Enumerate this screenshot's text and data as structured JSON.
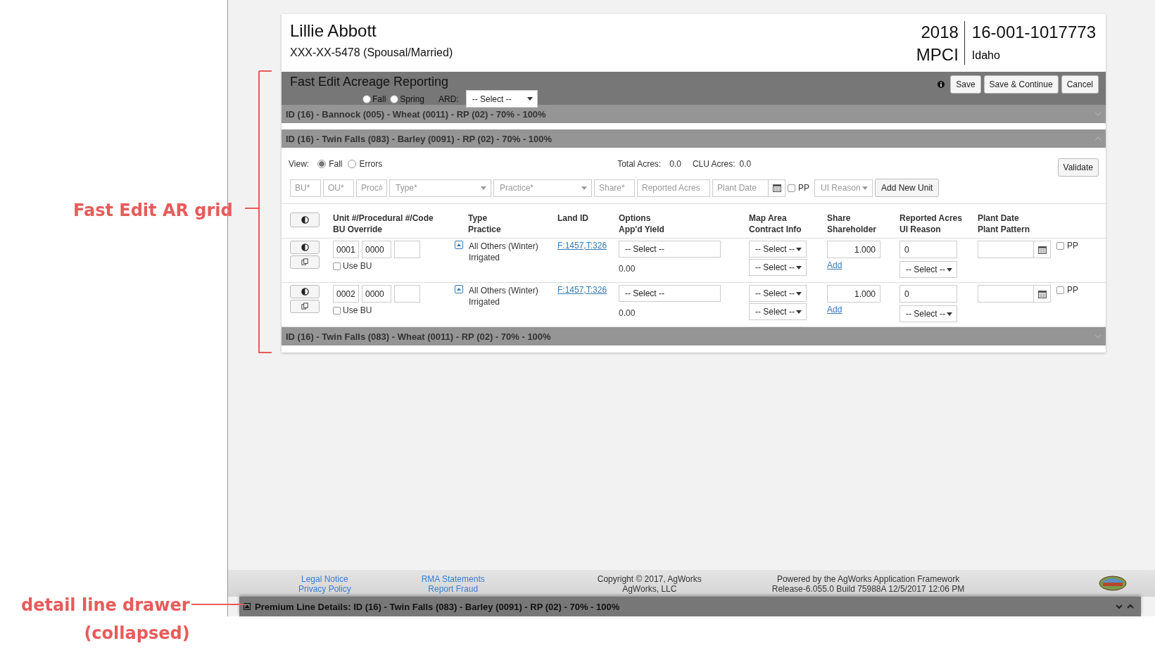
{
  "annotations": [
    {
      "kind": "bracket",
      "lines": [
        "Fast Edit AR grid"
      ]
    },
    {
      "kind": "leader",
      "lines": [
        "detail line drawer",
        "(collapsed)"
      ]
    }
  ],
  "header": {
    "name": "Lillie Abbott",
    "ssn": "XXX-XX-5478 (Spousal/Married)",
    "year": "2018",
    "program": "MPCI",
    "policy": "16-001-1017773",
    "state": "Idaho"
  },
  "toolbar": {
    "title": "Fast Edit Acreage Reporting",
    "seasons": [
      {
        "label": "Fall",
        "selected": false
      },
      {
        "label": "Spring",
        "selected": false
      }
    ],
    "ard_label": "ARD:",
    "ard_select": "-- Select --",
    "buttons": [
      "Save",
      "Save & Continue",
      "Cancel"
    ]
  },
  "sections": [
    {
      "title": "ID (16) - Bannock (005) - Wheat (0011) - RP (02) - 70% - 100%",
      "expanded": false
    },
    {
      "title": "ID (16) - Twin Falls (083) - Barley (0091) - RP (02) - 70% - 100%",
      "expanded": true
    },
    {
      "title": "ID (16) - Twin Falls (083) - Wheat (0011) - RP (02) - 70% - 100%",
      "expanded": false
    }
  ],
  "grid": {
    "view_label": "View:",
    "view_options": [
      {
        "label": "Fall",
        "selected": true
      },
      {
        "label": "Errors",
        "selected": false
      }
    ],
    "total_acres_label": "Total Acres:",
    "total_acres": "0.0",
    "clu_acres_label": "CLU Acres:",
    "clu_acres": "0.0",
    "validate_button": "Validate",
    "entry_fields": [
      {
        "kind": "input",
        "placeholder": "BU*"
      },
      {
        "kind": "input",
        "placeholder": "OU*"
      },
      {
        "kind": "input",
        "placeholder": "Proc#"
      },
      {
        "kind": "select",
        "placeholder": "Type*"
      },
      {
        "kind": "select",
        "placeholder": "Practice*"
      },
      {
        "kind": "input",
        "placeholder": "Share*"
      },
      {
        "kind": "input",
        "placeholder": "Reported Acres"
      },
      {
        "kind": "date",
        "placeholder": "Plant Date"
      },
      {
        "kind": "checkbox",
        "label": "PP",
        "checked": false
      },
      {
        "kind": "select",
        "placeholder": "UI Reason"
      },
      {
        "kind": "button",
        "label": "Add New Unit"
      }
    ],
    "columns": [
      {
        "title": "Unit #/Procedural #/Code",
        "subtitle": "BU Override"
      },
      {
        "title": "Type",
        "subtitle": "Practice"
      },
      {
        "title": "Land ID"
      },
      {
        "title": "Options",
        "subtitle": "App'd Yield"
      },
      {
        "title": "Map Area",
        "subtitle": "Contract Info"
      },
      {
        "title": "Share",
        "subtitle": "Shareholder"
      },
      {
        "title": "Reported Acres",
        "subtitle": "UI Reason"
      },
      {
        "title": "Plant Date",
        "subtitle": "Plant Pattern"
      }
    ],
    "rows": [
      {
        "unit": "0001",
        "procedural": "0000",
        "use_bu_label": "Use BU",
        "use_bu": false,
        "type": "All Others (Winter)",
        "practice": "Irrigated",
        "land_id": "F:1457,T:326",
        "options": "-- Select --",
        "yield": "0.00",
        "map_area": "-- Select --",
        "contract_info": "-- Select --",
        "share": "1.000",
        "shareholder_link": "Add",
        "reported_acres": "0",
        "ui_reason": "-- Select --",
        "pp_label": "PP",
        "pp": false
      },
      {
        "unit": "0002",
        "procedural": "0000",
        "use_bu_label": "Use BU",
        "use_bu": false,
        "type": "All Others (Winter)",
        "practice": "Irrigated",
        "land_id": "F:1457,T:326",
        "options": "-- Select --",
        "yield": "0.00",
        "map_area": "-- Select --",
        "contract_info": "-- Select --",
        "share": "1.000",
        "shareholder_link": "Add",
        "reported_acres": "0",
        "ui_reason": "-- Select --",
        "pp_label": "PP",
        "pp": false
      }
    ]
  },
  "footer": {
    "links_1": [
      "Legal Notice",
      "Privacy Policy"
    ],
    "links_2": [
      "RMA Statements",
      "Report Fraud"
    ],
    "copyright": [
      "Copyright © 2017, AgWorks",
      "AgWorks, LLC"
    ],
    "powered": [
      "Powered by the AgWorks Application Framework",
      "Release-6.055.0 Build 75988A 12/5/2017 12:06 PM"
    ]
  },
  "drawer": {
    "title": "Premium Line Details: ID (16) - Twin Falls (083) - Barley (0091) - RP (02) - 70% - 100%",
    "expanded": false
  }
}
